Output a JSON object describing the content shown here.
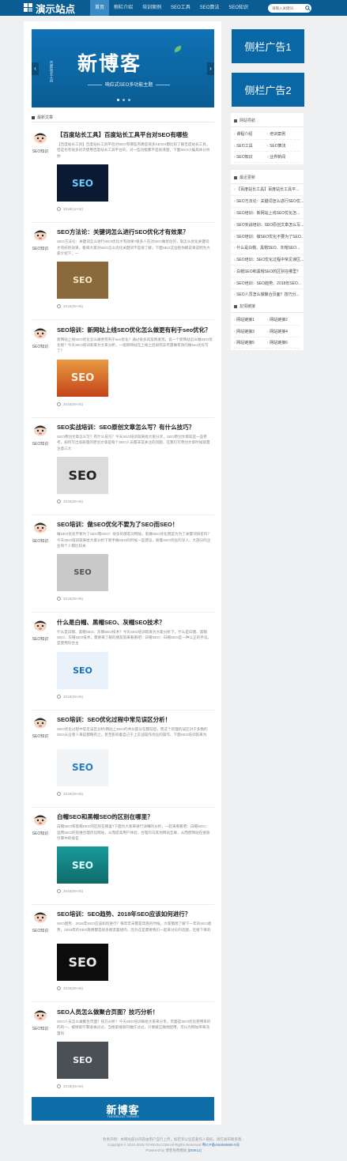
{
  "header": {
    "logo": "演示站点",
    "nav": [
      "首页",
      "侧栏介绍",
      "培训案例",
      "SEO工具",
      "SEO算法",
      "SEO知识"
    ],
    "search_placeholder": "请输入关键词..."
  },
  "banner": {
    "sub": "百度站长工具",
    "title": "新博客",
    "tagline": "响应式SEO多功能主题"
  },
  "section_title": "最新文章",
  "posts": [
    {
      "author": "SEO知识",
      "title": "【百度站长工具】百度站长工具平台对SEO有哪些",
      "excerpt": "【百度站长工具】百度站长工具平台对SEO有哪些有哪些很多SEOer都比较了解百度站长工具，但是也有很多初次使用百度站长工具平台的，对一些功能都不是很清楚，下面SEO小编具体分析你",
      "date": "2018(12-04)",
      "thumb": "SEO"
    },
    {
      "author": "SEO知识",
      "title": "SEO方法论：关键词怎么进行SEO优化才有效果？",
      "excerpt": "SEO方法论：关键词怎么进行SEO优化才有效果?很多人在对SEO做优化的，就怎么优化关键词才有好的效果，看来大家对SEO怎么优化关键词不是很了解，下面SEO这边给你解说来说明为大家介绍下，一",
      "date": "2018(09-06)",
      "thumb": "SEO"
    },
    {
      "author": "SEO知识",
      "title": "SEO培训：新网站上线SEO优化怎么做更有利于seo优化？",
      "excerpt": "新网站上线SEO优化怎么做更有利于seo优化？通过很多的案例发现，说一个新网站怎么做SEO优化呢？今天SEO培训就来为大家分析，一般新网站在上线之后如何去尽量做有效的做seo优化写了？",
      "date": "2018(09-06)",
      "thumb": "SEO"
    },
    {
      "author": "SEO知识",
      "title": "SEO实战培训：SEO原创文章怎么写？有什么技巧？",
      "excerpt": "SEO原创文章怎么写？有什么技巧？今天SEO培训就来给大家分享，SEO原创文章就是一些参考，如何写出高质量的原创文章是每个SEO人员都非常关注的问题，在我们写原创文章时候就需注意三大",
      "date": "2018(09-06)",
      "thumb": "SEO"
    },
    {
      "author": "SEO知识",
      "title": "SEO培训：做SEO优化不要为了SEO而SEO！",
      "excerpt": "做SEO优化不要为了SEO而SEO！很多的朋友对网站，就做SEO优化而是为为了关键词排名吗？今天SEO培训就来给大家分析下新手做SEO的时候一些建议，随着SEO优化的深入，大部分的企业和个人都比较关",
      "date": "2018(09-06)",
      "thumb": "SEO"
    },
    {
      "author": "SEO知识",
      "title": "什么是白帽、黑帽SEO、灰帽SEO技术？",
      "excerpt": "什么是白帽、黑帽SEO、灰帽SEO技术？今天SEO培训就来为大家分析下，什么是白帽、黑帽SEO、灰帽SEO技术，需要来了解的朋友就来看看吧：白帽SEO：白帽SEO是一种公正的手法，是使用符合主",
      "date": "2018(09-06)",
      "thumb": "SEO"
    },
    {
      "author": "SEO知识",
      "title": "SEO培训：SEO优化过程中常见误区分析！",
      "excerpt": "SEO优化过程中常见误区分析!网站上SEO的共分部分在都前后，而这个的理的误区对于多数的SEO从业者人来说都略有之，甚至影响着自己于上实战操作优化的操作。下面SEO培训就来为",
      "date": "2018(09-06)",
      "thumb": "SEO"
    },
    {
      "author": "SEO知识",
      "title": "白帽SEO和黑帽SEO的区别在哪里？",
      "excerpt": "白帽SEO和黑帽SEO的区别在哪里?下面为大家来进行详细的分析，一起来看看吧：白帽SEO：运用SEO的思维合理优化网站，从而提高用户体验，合理的与其他网站互联，从而使网站在搜索引擎中的排名",
      "date": "2018(09-06)",
      "thumb": "SEO"
    },
    {
      "author": "SEO知识",
      "title": "SEO培训：SEO趋势、2018年SEO应该如何进行？",
      "excerpt": "SEO趋势、2018年SEO应该如何进行？每年年末都是年底的时候，大家都想了解下一年的SEO趋势，2018年的SEO我想都是很多朋友最想的，因为这是需要我们一起来讨论的话题，在接下来的",
      "date": "2018(09-06)",
      "thumb": "SEO"
    },
    {
      "author": "SEO知识",
      "title": "SEO人员怎么做聚合页面？技巧分析！",
      "excerpt": "SEO人员怎么做聚合页面？技巧分析！今天SEO培训来给大家来分享，页面是SEO优化使用率的的的一，被搜索引擎收录过过，当搜索搜索的做打过过，只要被正确地配用，可以为网站带来流量的",
      "date": "2018(09-06)",
      "thumb": "SEO"
    }
  ],
  "bottom_banner": {
    "title": "新博客",
    "sub": "THEWBLOG THEMES"
  },
  "sidebar": {
    "ad1": "侧栏广告1",
    "ad2": "侧栏广告2",
    "nav_title": "网站导航",
    "nav_links": [
      "课程介绍",
      "培训案例",
      "SEO工具",
      "SEO算法",
      "SEO知识",
      "业界新闻"
    ],
    "recent_title": "最近更新",
    "recent": [
      "【百度站长工具】百度站长工具平...",
      "SEO方法论：关键词怎么进行SEO优...",
      "SEO培训：新网站上线SEO优化怎...",
      "SEO实战培训：SEO原创文章怎么写...",
      "SEO培训：做SEO优化不要为了SEO...",
      "什么是白帽、黑帽SEO、灰帽SEO...",
      "SEO培训：SEO优化过程中常见误区...",
      "白帽SEO和黑帽SEO的区别在哪里？",
      "SEO培训：SEO趋势、2018年SEO...",
      "SEO人员怎么做聚合页面？技巧分..."
    ],
    "friends_title": "友情链接",
    "friends": [
      "网站链接1",
      "网站链接2",
      "网站链接3",
      "网站链接4",
      "网站链接5",
      "网站链接6"
    ]
  },
  "footer": {
    "line1": "免责声明：本网站部分内容由用户自行上传，如若有认您是著作人侵权，请在发布联系我...",
    "line2": "Copyright © 2010-2019 TOYEAN.COM All Rights Reserved",
    "icp": "粤ICP备456888888-5号",
    "line3": "Powered by 博客免费模板",
    "line3b": "[DDB12]"
  }
}
